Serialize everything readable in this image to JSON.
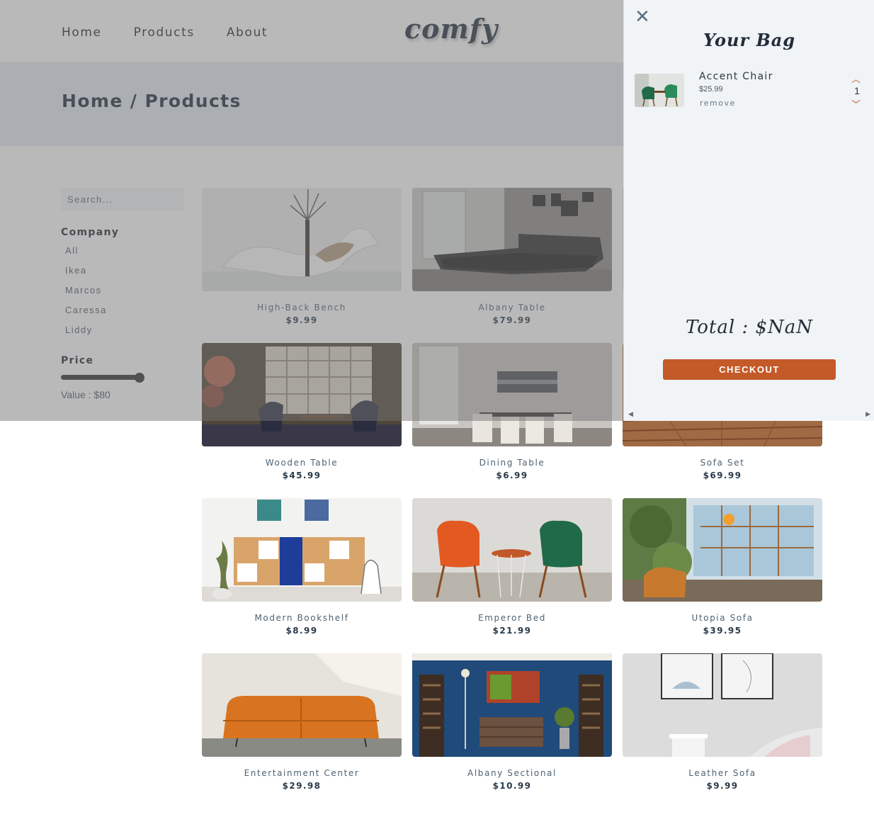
{
  "navbar": {
    "links": [
      "Home",
      "Products",
      "About"
    ],
    "logo": "comfy"
  },
  "hero": {
    "title": "Home / Products"
  },
  "filters": {
    "search_placeholder": "Search...",
    "company_heading": "Company",
    "companies": [
      "All",
      "Ikea",
      "Marcos",
      "Caressa",
      "Liddy"
    ],
    "price_heading": "Price",
    "price_value_label": "Value : $80",
    "price_fraction": 0.9
  },
  "products": [
    {
      "name": "High-Back Bench",
      "price": "$9.99"
    },
    {
      "name": "Albany Table",
      "price": "$79.99"
    },
    {
      "name": "",
      "price": ""
    },
    {
      "name": "Wooden Table",
      "price": "$45.99"
    },
    {
      "name": "Dining Table",
      "price": "$6.99"
    },
    {
      "name": "Sofa Set",
      "price": "$69.99"
    },
    {
      "name": "Modern Bookshelf",
      "price": "$8.99"
    },
    {
      "name": "Emperor Bed",
      "price": "$21.99"
    },
    {
      "name": "Utopia Sofa",
      "price": "$39.95"
    },
    {
      "name": "Entertainment Center",
      "price": "$29.98"
    },
    {
      "name": "Albany Sectional",
      "price": "$10.99"
    },
    {
      "name": "Leather Sofa",
      "price": "$9.99"
    }
  ],
  "cart": {
    "close_icon": "close-icon",
    "title": "Your Bag",
    "item": {
      "name": "Accent Chair",
      "price": "$25.99",
      "remove_label": "remove",
      "quantity": "1"
    },
    "total": "Total : $NaN",
    "checkout_label": "CHECKOUT"
  },
  "colors": {
    "accent": "#c45a28",
    "text_dark": "#1d2733",
    "cart_bg": "#f0f4f7",
    "hero_bg": "#e3e9f0"
  }
}
